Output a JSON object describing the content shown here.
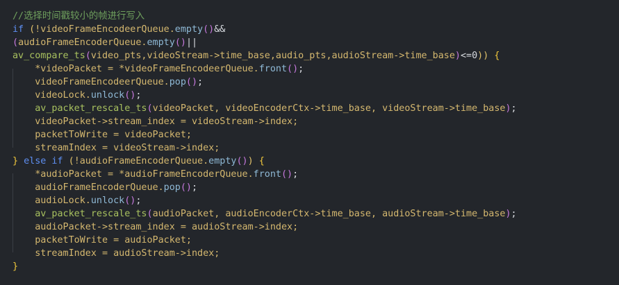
{
  "editor": {
    "lines": [
      [
        {
          "text": "//选择时间戳较小的帧进行写入",
          "cls": "t-comment"
        }
      ],
      [
        {
          "text": "if",
          "cls": "t-keyword"
        },
        {
          "text": " (",
          "cls": "t-paren"
        },
        {
          "text": "!videoFrameEncodeerQueue.",
          "cls": "t-ident"
        },
        {
          "text": "empty",
          "cls": "t-member"
        },
        {
          "text": "()",
          "cls": "t-paren2"
        },
        {
          "text": "&&",
          "cls": "t-op"
        }
      ],
      [
        {
          "text": "(",
          "cls": "t-paren2"
        },
        {
          "text": "audioFrameEncoderQueue.",
          "cls": "t-ident"
        },
        {
          "text": "empty",
          "cls": "t-member"
        },
        {
          "text": "()",
          "cls": "t-paren2"
        },
        {
          "text": "||",
          "cls": "t-op"
        }
      ],
      [
        {
          "text": "av_compare_ts",
          "cls": "t-func"
        },
        {
          "text": "(",
          "cls": "t-paren2"
        },
        {
          "text": "video_pts,videoStream->time_base,audio_pts,audioStream->time_base",
          "cls": "t-ident"
        },
        {
          "text": ")",
          "cls": "t-paren2"
        },
        {
          "text": "<=0",
          "cls": "t-op"
        },
        {
          "text": "))",
          "cls": "t-paren"
        },
        {
          "text": " {",
          "cls": "t-brace"
        }
      ],
      [
        {
          "text": "    *videoPacket = *videoFrameEncodeerQueue.",
          "cls": "t-ident"
        },
        {
          "text": "front",
          "cls": "t-member"
        },
        {
          "text": "()",
          "cls": "t-paren2"
        },
        {
          "text": ";",
          "cls": "t-op"
        }
      ],
      [
        {
          "text": "    videoFrameEncodeerQueue.",
          "cls": "t-ident"
        },
        {
          "text": "pop",
          "cls": "t-member"
        },
        {
          "text": "()",
          "cls": "t-paren2"
        },
        {
          "text": ";",
          "cls": "t-op"
        }
      ],
      [
        {
          "text": "    videoLock.",
          "cls": "t-ident"
        },
        {
          "text": "unlock",
          "cls": "t-member"
        },
        {
          "text": "()",
          "cls": "t-paren2"
        },
        {
          "text": ";",
          "cls": "t-op"
        }
      ],
      [
        {
          "text": "    ",
          "cls": "t-op"
        },
        {
          "text": "av_packet_rescale_ts",
          "cls": "t-func"
        },
        {
          "text": "(",
          "cls": "t-paren2"
        },
        {
          "text": "videoPacket, videoEncoderCtx->time_base, videoStream->time_base",
          "cls": "t-ident"
        },
        {
          "text": ")",
          "cls": "t-paren2"
        },
        {
          "text": ";",
          "cls": "t-op"
        }
      ],
      [
        {
          "text": "    videoPacket->stream_index = videoStream->index;",
          "cls": "t-ident"
        }
      ],
      [
        {
          "text": "    packetToWrite = videoPacket;",
          "cls": "t-ident"
        }
      ],
      [
        {
          "text": "    streamIndex = videoStream->index;",
          "cls": "t-ident"
        }
      ],
      [
        {
          "text": "}",
          "cls": "t-brace"
        },
        {
          "text": " else if ",
          "cls": "t-keyword"
        },
        {
          "text": "(",
          "cls": "t-paren"
        },
        {
          "text": "!audioFrameEncoderQueue.",
          "cls": "t-ident"
        },
        {
          "text": "empty",
          "cls": "t-member"
        },
        {
          "text": "()",
          "cls": "t-paren2"
        },
        {
          "text": ")",
          "cls": "t-paren"
        },
        {
          "text": " {",
          "cls": "t-brace"
        }
      ],
      [
        {
          "text": "    *audioPacket = *audioFrameEncoderQueue.",
          "cls": "t-ident"
        },
        {
          "text": "front",
          "cls": "t-member"
        },
        {
          "text": "()",
          "cls": "t-paren2"
        },
        {
          "text": ";",
          "cls": "t-op"
        }
      ],
      [
        {
          "text": "    audioFrameEncoderQueue.",
          "cls": "t-ident"
        },
        {
          "text": "pop",
          "cls": "t-member"
        },
        {
          "text": "()",
          "cls": "t-paren2"
        },
        {
          "text": ";",
          "cls": "t-op"
        }
      ],
      [
        {
          "text": "    audioLock.",
          "cls": "t-ident"
        },
        {
          "text": "unlock",
          "cls": "t-member"
        },
        {
          "text": "()",
          "cls": "t-paren2"
        },
        {
          "text": ";",
          "cls": "t-op"
        }
      ],
      [
        {
          "text": "    ",
          "cls": "t-op"
        },
        {
          "text": "av_packet_rescale_ts",
          "cls": "t-func"
        },
        {
          "text": "(",
          "cls": "t-paren2"
        },
        {
          "text": "audioPacket, audioEncoderCtx->time_base, audioStream->time_base",
          "cls": "t-ident"
        },
        {
          "text": ")",
          "cls": "t-paren2"
        },
        {
          "text": ";",
          "cls": "t-op"
        }
      ],
      [
        {
          "text": "    audioPacket->stream_index = audioStream->index;",
          "cls": "t-ident"
        }
      ],
      [
        {
          "text": "    packetToWrite = audioPacket;",
          "cls": "t-ident"
        }
      ],
      [
        {
          "text": "    streamIndex = audioStream->index;",
          "cls": "t-ident"
        }
      ],
      [
        {
          "text": "}",
          "cls": "t-brace"
        }
      ]
    ]
  }
}
